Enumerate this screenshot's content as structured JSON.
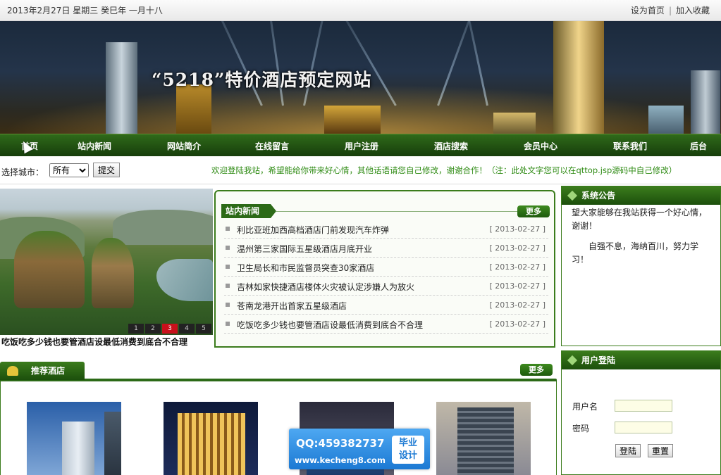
{
  "topbar": {
    "date": "2013年2月27日  星期三  癸巳年  一月十八",
    "set_home": "设为首页",
    "separator": "|",
    "add_favorite": "加入收藏"
  },
  "banner": {
    "title": "“5218”特价酒店预定网站"
  },
  "nav": {
    "items": [
      "首页",
      "站内新闻",
      "网站简介",
      "在线留言",
      "用户注册",
      "酒店搜索",
      "会员中心",
      "联系我们",
      "后台"
    ]
  },
  "search": {
    "city_label": "选择城市：",
    "city_value": "所有",
    "submit_label": "提交",
    "welcome": "欢迎登陆我站，希望能给你带来好心情，其他话语请您自己修改，谢谢合作！（注：此处文字您可以在qttop.jsp源码中自己修改）"
  },
  "slider": {
    "pages": [
      "1",
      "2",
      "3",
      "4",
      "5"
    ],
    "active_page": "3",
    "caption": "吃饭吃多少钱也要管酒店设最低消费到底合不合理"
  },
  "news": {
    "title": "站内新闻",
    "more": "更多",
    "items": [
      {
        "title": "利比亚班加西高档酒店门前发现汽车炸弹",
        "date": "[ 2013-02-27 ]"
      },
      {
        "title": "温州第三家国际五星级酒店月底开业",
        "date": "[ 2013-02-27 ]"
      },
      {
        "title": "卫生局长和市民监督员突查30家酒店",
        "date": "[ 2013-02-27 ]"
      },
      {
        "title": "吉林如家快捷酒店楼体火灾被认定涉嫌人为放火",
        "date": "[ 2013-02-27 ]"
      },
      {
        "title": "苍南龙港开出首家五星级酒店",
        "date": "[ 2013-02-27 ]"
      },
      {
        "title": "吃饭吃多少钱也要管酒店设最低消费到底合不合理",
        "date": "[ 2013-02-27 ]"
      }
    ]
  },
  "notice": {
    "title": "系统公告",
    "line1": "望大家能够在我站获得一个好心情，谢谢！",
    "line2": "自强不息，海纳百川，努力学习！"
  },
  "login": {
    "title": "用户登陆",
    "username_label": "用户名",
    "password_label": "密码",
    "login_button": "登陆",
    "reset_button": "重置"
  },
  "hotels": {
    "title": "推荐酒店",
    "more": "更多"
  },
  "watermark": {
    "qq": "QQ:459382737",
    "site": "www.kecheng8.com",
    "badge_line1": "毕业",
    "badge_line2": "设计"
  },
  "colors": {
    "nav_green": "#1f4d10",
    "accent_green": "#2c6a17",
    "welcome_green": "#2d8a12",
    "active_page_red": "#c8101b"
  }
}
